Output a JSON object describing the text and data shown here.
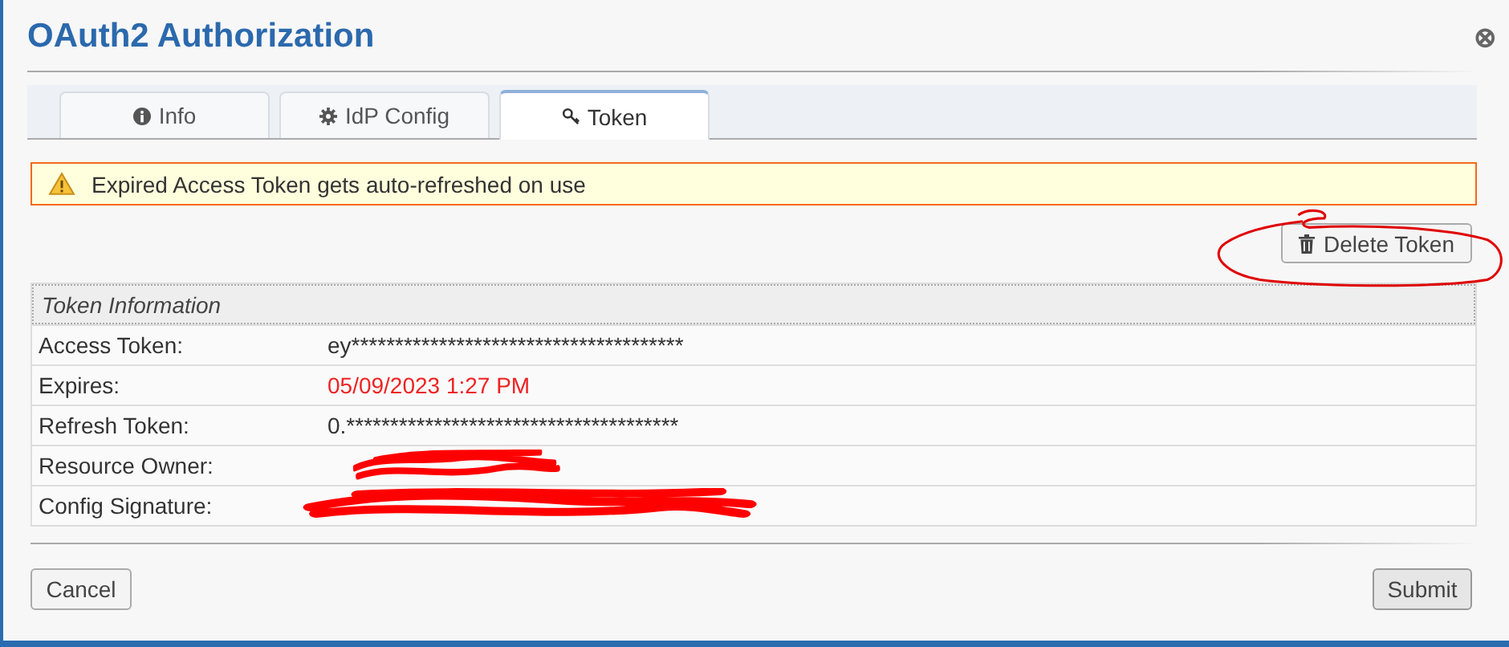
{
  "dialog": {
    "title": "OAuth2 Authorization",
    "close_label": "⊗"
  },
  "tabs": [
    {
      "label": "Info",
      "selected": false
    },
    {
      "label": "IdP Config",
      "selected": false
    },
    {
      "label": "Token",
      "selected": true
    }
  ],
  "alert": {
    "text": "Expired Access Token gets auto-refreshed on use"
  },
  "delete_button": {
    "label": "Delete Token",
    "circled": true
  },
  "token_table": {
    "heading": "Token Information",
    "rows": [
      {
        "label": "Access Token:",
        "value": "ey**************************************",
        "expired": false,
        "redacted": false
      },
      {
        "label": "Expires:",
        "value": "05/09/2023 1:27 PM",
        "expired": true,
        "redacted": false
      },
      {
        "label": "Refresh Token:",
        "value": "0.**************************************",
        "expired": false,
        "redacted": false
      },
      {
        "label": "Resource Owner:",
        "redacted": true
      },
      {
        "label": "Config Signature:",
        "redacted": true
      }
    ]
  },
  "buttons": [
    {
      "label": "Cancel",
      "kind": "cancel"
    },
    {
      "label": "Submit",
      "kind": "submit"
    }
  ]
}
